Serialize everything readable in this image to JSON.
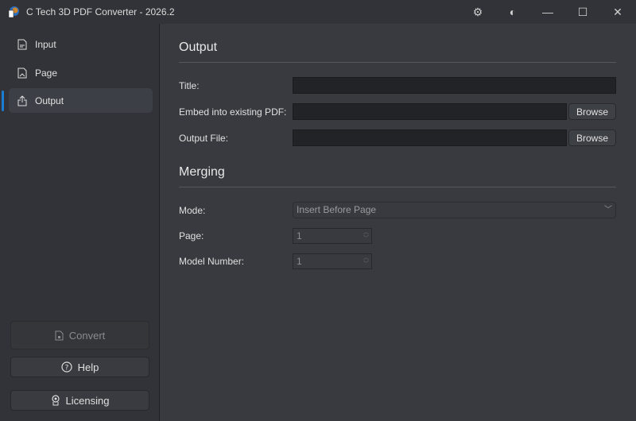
{
  "window": {
    "title": "C Tech 3D PDF Converter - 2026.2"
  },
  "sidebar": {
    "items": [
      {
        "label": "Input"
      },
      {
        "label": "Page"
      },
      {
        "label": "Output"
      }
    ],
    "convert_label": "Convert",
    "help_label": "Help",
    "licensing_label": "Licensing"
  },
  "output": {
    "heading": "Output",
    "title_label": "Title:",
    "title_value": "",
    "embed_label": "Embed into existing PDF:",
    "embed_value": "",
    "output_file_label": "Output File:",
    "output_file_value": "",
    "browse_label": "Browse"
  },
  "merging": {
    "heading": "Merging",
    "mode_label": "Mode:",
    "mode_value": "Insert Before Page",
    "page_label": "Page:",
    "page_value": "1",
    "model_number_label": "Model Number:",
    "model_number_value": "1"
  },
  "colors": {
    "accent": "#1a7fd4"
  }
}
